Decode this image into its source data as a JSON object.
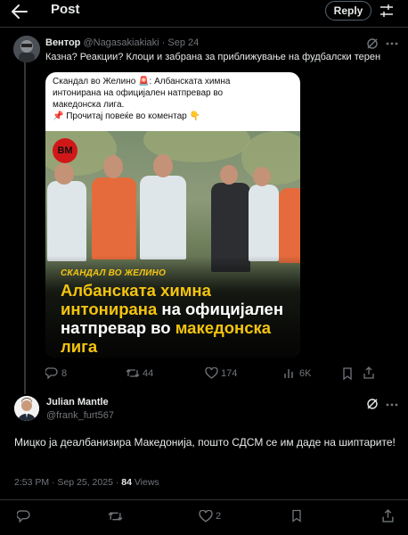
{
  "header": {
    "title": "Post",
    "reply_label": "Reply",
    "back_icon": "arrow-left-icon",
    "settings_icon": "sliders-icon"
  },
  "original_post": {
    "author_name": "Вентор",
    "author_handle": "@Nagasakiakiaki",
    "date": "· Sep 24",
    "text": "Казна? Реакции? Клоци и забрана за приближување на фудбалски терен",
    "card": {
      "text_line1": "Скандал во Желино 🚨: Албанската химна",
      "text_line2": "интонирана на официјален натпревар во",
      "text_line3": "македонска лига.",
      "text_line4": "📌 Прочитај повеќе во коментар 👇",
      "logo": "BM",
      "kicker": "СКАНДАЛ ВО ЖЕЛИНО",
      "headline_a": "Албанската химна",
      "headline_b": "интонирана",
      "headline_c": " на официјален",
      "headline_d": "натпревар во ",
      "headline_e": "македонска",
      "headline_f": "лига"
    },
    "actions": {
      "replies": "8",
      "reposts": "44",
      "likes": "174",
      "views": "6K"
    }
  },
  "reply_post": {
    "author_name": "Julian Mantle",
    "author_handle": "@frank_furt567",
    "text": "Мицко ја деалбанизира Македонија, пошто СДСМ се им даде на шиптарите!",
    "time": "2:53 PM · Sep 25, 2025 · ",
    "views_count": "84",
    "views_label": " Views",
    "actions": {
      "likes": "2"
    }
  },
  "colors": {
    "background": "#000000",
    "text": "#e7e9ea",
    "muted": "#71767b",
    "accent_yellow": "#f4c40f",
    "logo_red": "#d11818"
  }
}
